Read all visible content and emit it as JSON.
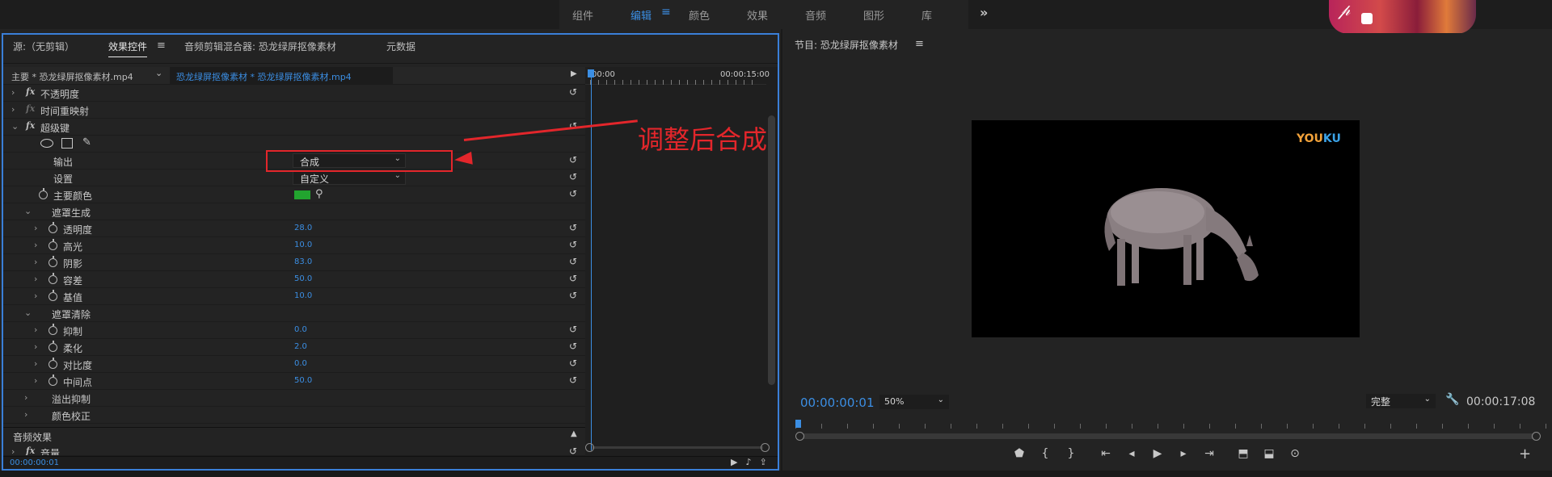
{
  "workspaces": {
    "tabs": [
      "组件",
      "编辑",
      "颜色",
      "效果",
      "音频",
      "图形",
      "库"
    ],
    "active": "编辑",
    "more": "»"
  },
  "left_panel": {
    "tabs": {
      "source": "源:（无剪辑）",
      "effect_controls": "效果控件",
      "mixer": "音频剪辑混合器: 恐龙绿屏抠像素材",
      "metadata": "元数据"
    },
    "clip": {
      "master": "主要 * 恐龙绿屏抠像素材.mp4",
      "sequence": "恐龙绿屏抠像素材 * 恐龙绿屏抠像素材.mp4"
    },
    "timeline": {
      "start": "00:00",
      "end": "00:00:15:00"
    },
    "effects": {
      "opacity": "不透明度",
      "time_remap": "时间重映射",
      "ultra_key": "超级键",
      "output_label": "输出",
      "output_value": "合成",
      "setting_label": "设置",
      "setting_value": "自定义",
      "key_color_label": "主要颜色",
      "key_color": "#22a52f",
      "matte_generation": "遮罩生成",
      "transparency_label": "透明度",
      "transparency_value": "28.0",
      "highlight_label": "高光",
      "highlight_value": "10.0",
      "shadow_label": "阴影",
      "shadow_value": "83.0",
      "tolerance_label": "容差",
      "tolerance_value": "50.0",
      "pedestal_label": "基值",
      "pedestal_value": "10.0",
      "matte_cleanup": "遮罩清除",
      "choke_label": "抑制",
      "choke_value": "0.0",
      "soften_label": "柔化",
      "soften_value": "2.0",
      "contrast_label": "对比度",
      "contrast_value": "0.0",
      "midpoint_label": "中间点",
      "midpoint_value": "50.0",
      "spill": "溢出抑制",
      "color_correction": "颜色校正"
    },
    "audio_effects": "音频效果",
    "volume": "音量",
    "timecode": "00:00:00:01"
  },
  "annotation": {
    "text": "调整后合成",
    "color": "#e3262b"
  },
  "program": {
    "title": "节目: 恐龙绿屏抠像素材",
    "watermark_a": "YOU",
    "watermark_b": "KU",
    "timecode": "00:00:00:01",
    "zoom": "50%",
    "resolution": "完整",
    "duration": "00:00:17:08"
  },
  "colors": {
    "accent": "#3b8ee3",
    "panel": "#232323",
    "highlight": "#e3262b"
  }
}
